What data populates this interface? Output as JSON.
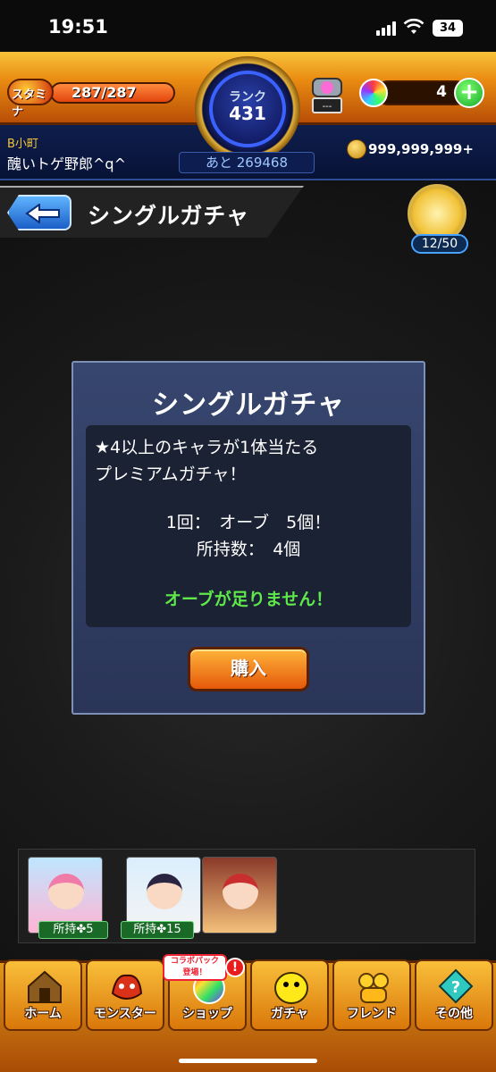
{
  "status_bar": {
    "time": "19:51",
    "battery": "34"
  },
  "hud": {
    "stamina_label": "スタミナ",
    "stamina_value": "287/287",
    "rank_label": "ランク",
    "rank_value": "431",
    "rank_next": "あと 269468",
    "orb_count": "4",
    "plus_label": "+",
    "player_rank_tag": "B小町",
    "player_name": "醜いトゲ野郎^q^",
    "coins": "999,999,999+",
    "lucky_label": "---"
  },
  "title_bar": {
    "title": "シングルガチャ",
    "mission_counter": "12/50"
  },
  "dialog": {
    "title": "シングルガチャ",
    "description_line1": "★4以上のキャラが1体当たる",
    "description_line2": "プレミアムガチャ！",
    "cost_line": "1回：　オーブ　5個！",
    "owned_line": "所持数：　4個",
    "warning": "オーブが足りません！",
    "buy_label": "購入"
  },
  "featured": {
    "items": [
      {
        "owned_label": "所持✤5"
      },
      {
        "owned_label": "所持✤15"
      },
      {
        "owned_label": ""
      }
    ]
  },
  "bottom_nav": {
    "items": [
      {
        "label": "ホーム",
        "icon": "home-icon"
      },
      {
        "label": "モンスター",
        "icon": "monster-icon"
      },
      {
        "label": "ショップ",
        "icon": "shop-icon"
      },
      {
        "label": "ガチャ",
        "icon": "gacha-icon"
      },
      {
        "label": "フレンド",
        "icon": "friend-icon"
      },
      {
        "label": "その他",
        "icon": "other-icon"
      }
    ],
    "collab_badge_line1": "コラボパック",
    "collab_badge_line2": "登場！",
    "alert": "!"
  }
}
